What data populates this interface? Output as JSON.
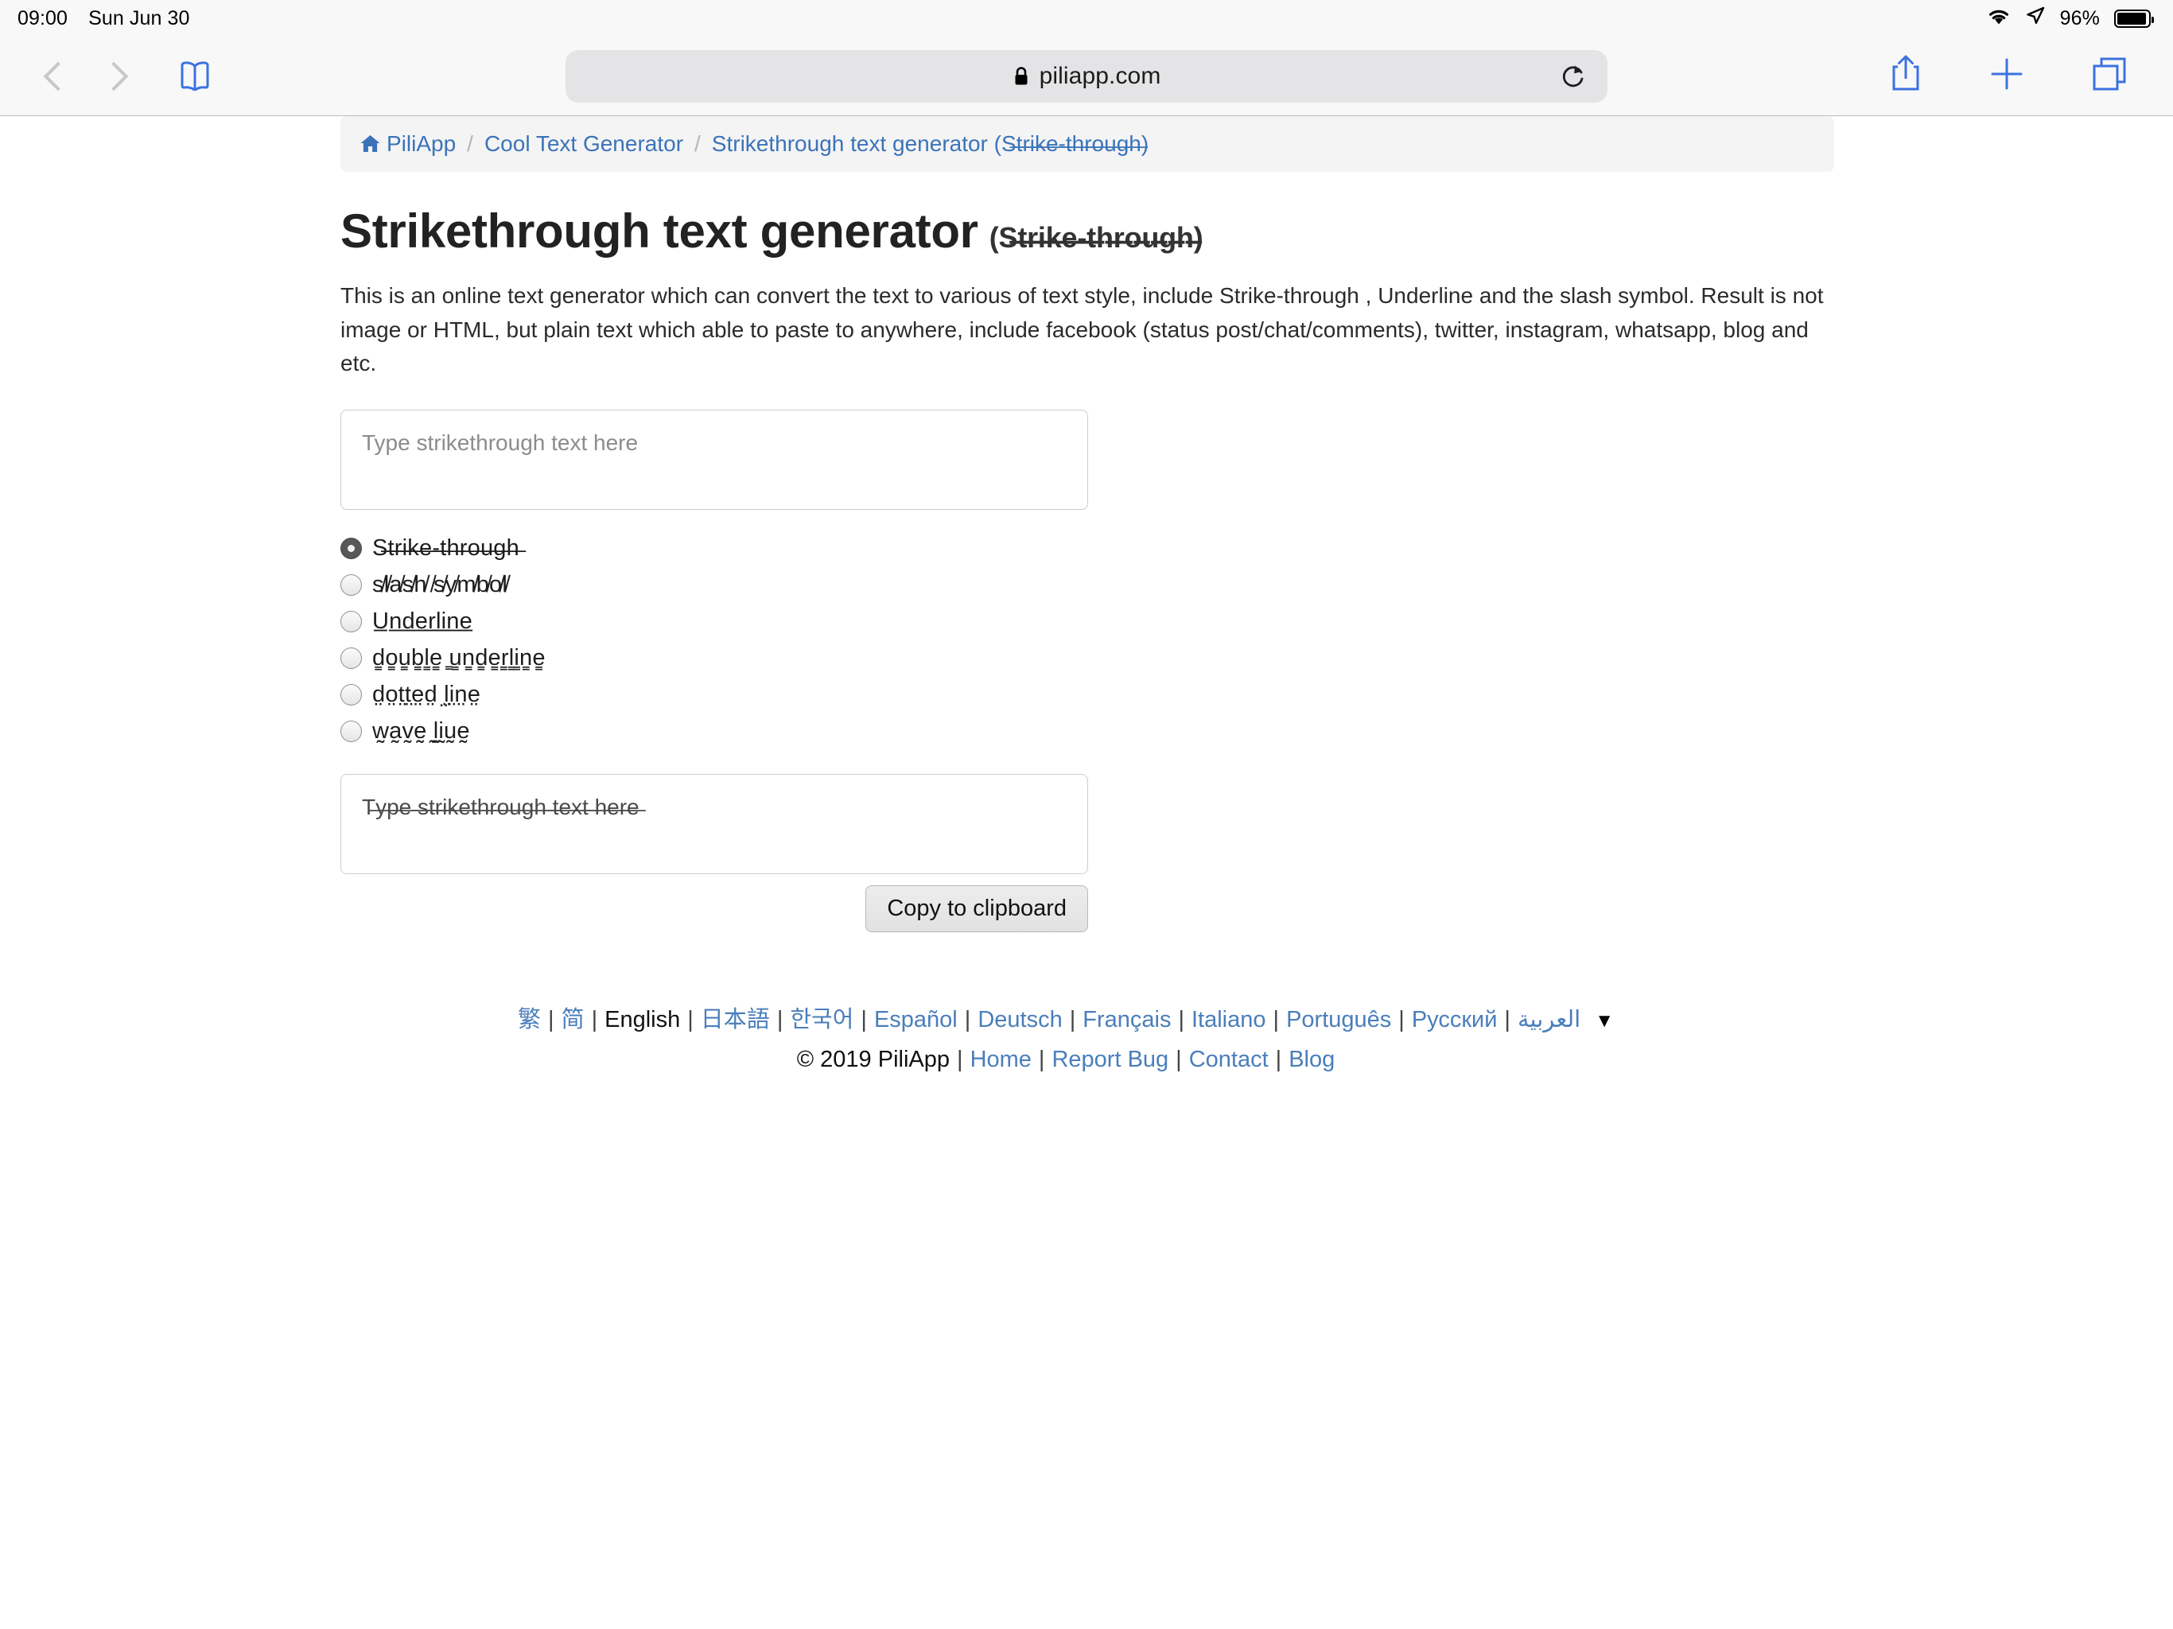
{
  "status_bar": {
    "time": "09:00",
    "date": "Sun Jun 30",
    "wifi_icon": "wifi-icon",
    "location_icon": "location-arrow-icon",
    "battery_percent": "96%",
    "battery_icon": "battery-full-icon"
  },
  "browser": {
    "back_icon": "chevron-left-icon",
    "forward_icon": "chevron-right-icon",
    "bookmarks_icon": "open-book-icon",
    "url": "piliapp.com",
    "lock_icon": "lock-icon",
    "reload_icon": "reload-icon",
    "share_icon": "share-icon",
    "new_tab_icon": "plus-icon",
    "tabs_icon": "tabs-icon"
  },
  "breadcrumb": {
    "home_icon": "home-icon",
    "items": [
      {
        "label": "PiliApp"
      },
      {
        "label": "Cool Text Generator"
      },
      {
        "label": "Strikethrough text generator (S̶t̶r̶i̶k̶e̶-̶t̶h̶r̶o̶u̶g̶h̶)"
      }
    ],
    "separator": "/"
  },
  "page": {
    "title": "Strikethrough text generator",
    "title_suffix": "(S̶t̶r̶i̶k̶e̶-̶t̶h̶r̶o̶u̶g̶h̶)",
    "description": "This is an online text generator which can convert the text to various of text style, include Strike-through , Underline and the slash symbol. Result is not image or HTML, but plain text which able to paste to anywhere, include facebook (status post/chat/comments), twitter, instagram, whatsapp, blog and etc.",
    "input": {
      "value": "",
      "placeholder": "Type strikethrough text here"
    },
    "options": [
      {
        "label": "S̶t̶r̶i̶k̶e̶-̶t̶h̶r̶o̶u̶g̶h̶",
        "checked": true
      },
      {
        "label": "s̸l̸a̸s̸h̸ ̸s̸y̸m̸b̸o̸l̸",
        "checked": false
      },
      {
        "label": "U̲n̲d̲e̲r̲l̲i̲n̲e̲",
        "checked": false
      },
      {
        "label": "d̳o̳u̳b̳l̳e̳ ̳u̳n̳d̳e̳r̳l̳i̳n̳e̳",
        "checked": false
      },
      {
        "label": "d̤o̤t̤t̤e̤d̤ ̤l̤i̤n̤e̤",
        "checked": false
      },
      {
        "label": "w̰a̰v̰ḛ ̰l̰ḭṵḛ",
        "checked": false
      }
    ],
    "output": {
      "value": "T̶y̶p̶e̶ ̶s̶t̶r̶i̶k̶e̶t̶h̶r̶o̶u̶g̶h̶ ̶t̶e̶x̶t̶ ̶h̶e̶r̶e̶"
    },
    "copy_button": "Copy to clipboard"
  },
  "footer": {
    "languages": [
      {
        "label": "繁",
        "current": false
      },
      {
        "label": "简",
        "current": false
      },
      {
        "label": "English",
        "current": true
      },
      {
        "label": "日本語",
        "current": false
      },
      {
        "label": "한국어",
        "current": false
      },
      {
        "label": "Español",
        "current": false
      },
      {
        "label": "Deutsch",
        "current": false
      },
      {
        "label": "Français",
        "current": false
      },
      {
        "label": "Italiano",
        "current": false
      },
      {
        "label": "Português",
        "current": false
      },
      {
        "label": "Русский",
        "current": false
      },
      {
        "label": "العربية",
        "current": false
      }
    ],
    "more_caret": "▼",
    "copyright": "© 2019 PiliApp",
    "links": [
      {
        "label": "Home"
      },
      {
        "label": "Report Bug"
      },
      {
        "label": "Contact"
      },
      {
        "label": "Blog"
      }
    ],
    "separator": "|"
  }
}
